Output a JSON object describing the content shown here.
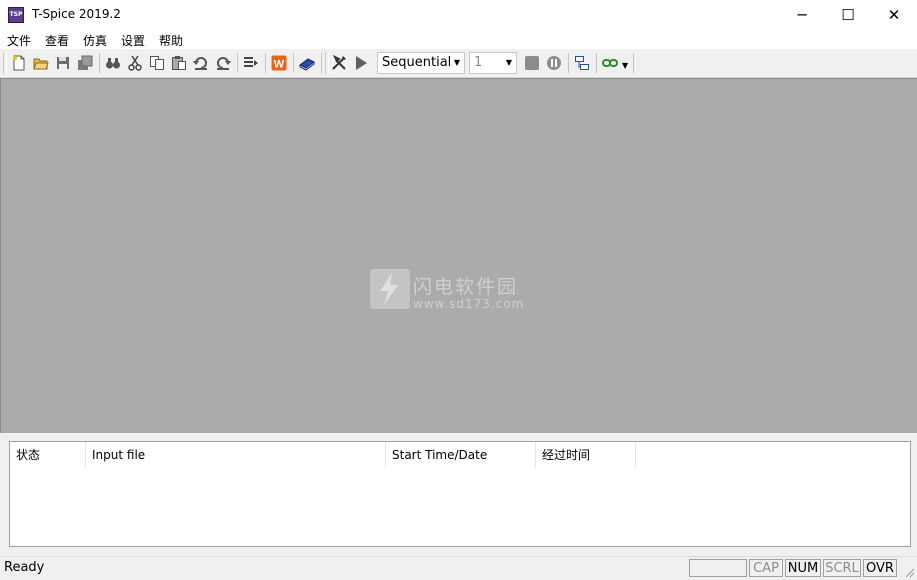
{
  "window": {
    "title": "T-Spice 2019.2",
    "icon_text": "TSP"
  },
  "window_controls": {
    "minimize": "─",
    "maximize": "☐",
    "close": "✕"
  },
  "menu": {
    "items": [
      "文件",
      "查看",
      "仿真",
      "设置",
      "帮助"
    ]
  },
  "toolbar": {
    "mode_select": {
      "value": "Sequential"
    },
    "count_select": {
      "value": "1"
    },
    "icons": [
      "new-file-icon",
      "open-folder-icon",
      "save-icon",
      "save-all-icon",
      "find-icon",
      "cut-icon",
      "copy-icon",
      "paste-icon",
      "undo-icon",
      "redo-icon",
      "insert-command-icon",
      "w-app-icon",
      "book-icon",
      "tools-icon",
      "run-icon",
      "stop-icon",
      "pause-icon",
      "window-layout-icon",
      "link-icon"
    ],
    "colors": {
      "w_icon": "#e8641e",
      "book": "#2a4aa8",
      "run": "#606060"
    }
  },
  "watermark": {
    "title": "闪电软件园",
    "subtitle": "www.sd173.com"
  },
  "simulation_list": {
    "columns": [
      "状态",
      "Input file",
      "Start Time/Date",
      "经过时间"
    ]
  },
  "status_bar": {
    "text": "Ready",
    "indicators": [
      {
        "label": "",
        "active": false
      },
      {
        "label": "CAP",
        "active": false
      },
      {
        "label": "NUM",
        "active": true
      },
      {
        "label": "SCRL",
        "active": false
      },
      {
        "label": "OVR",
        "active": true
      }
    ]
  }
}
